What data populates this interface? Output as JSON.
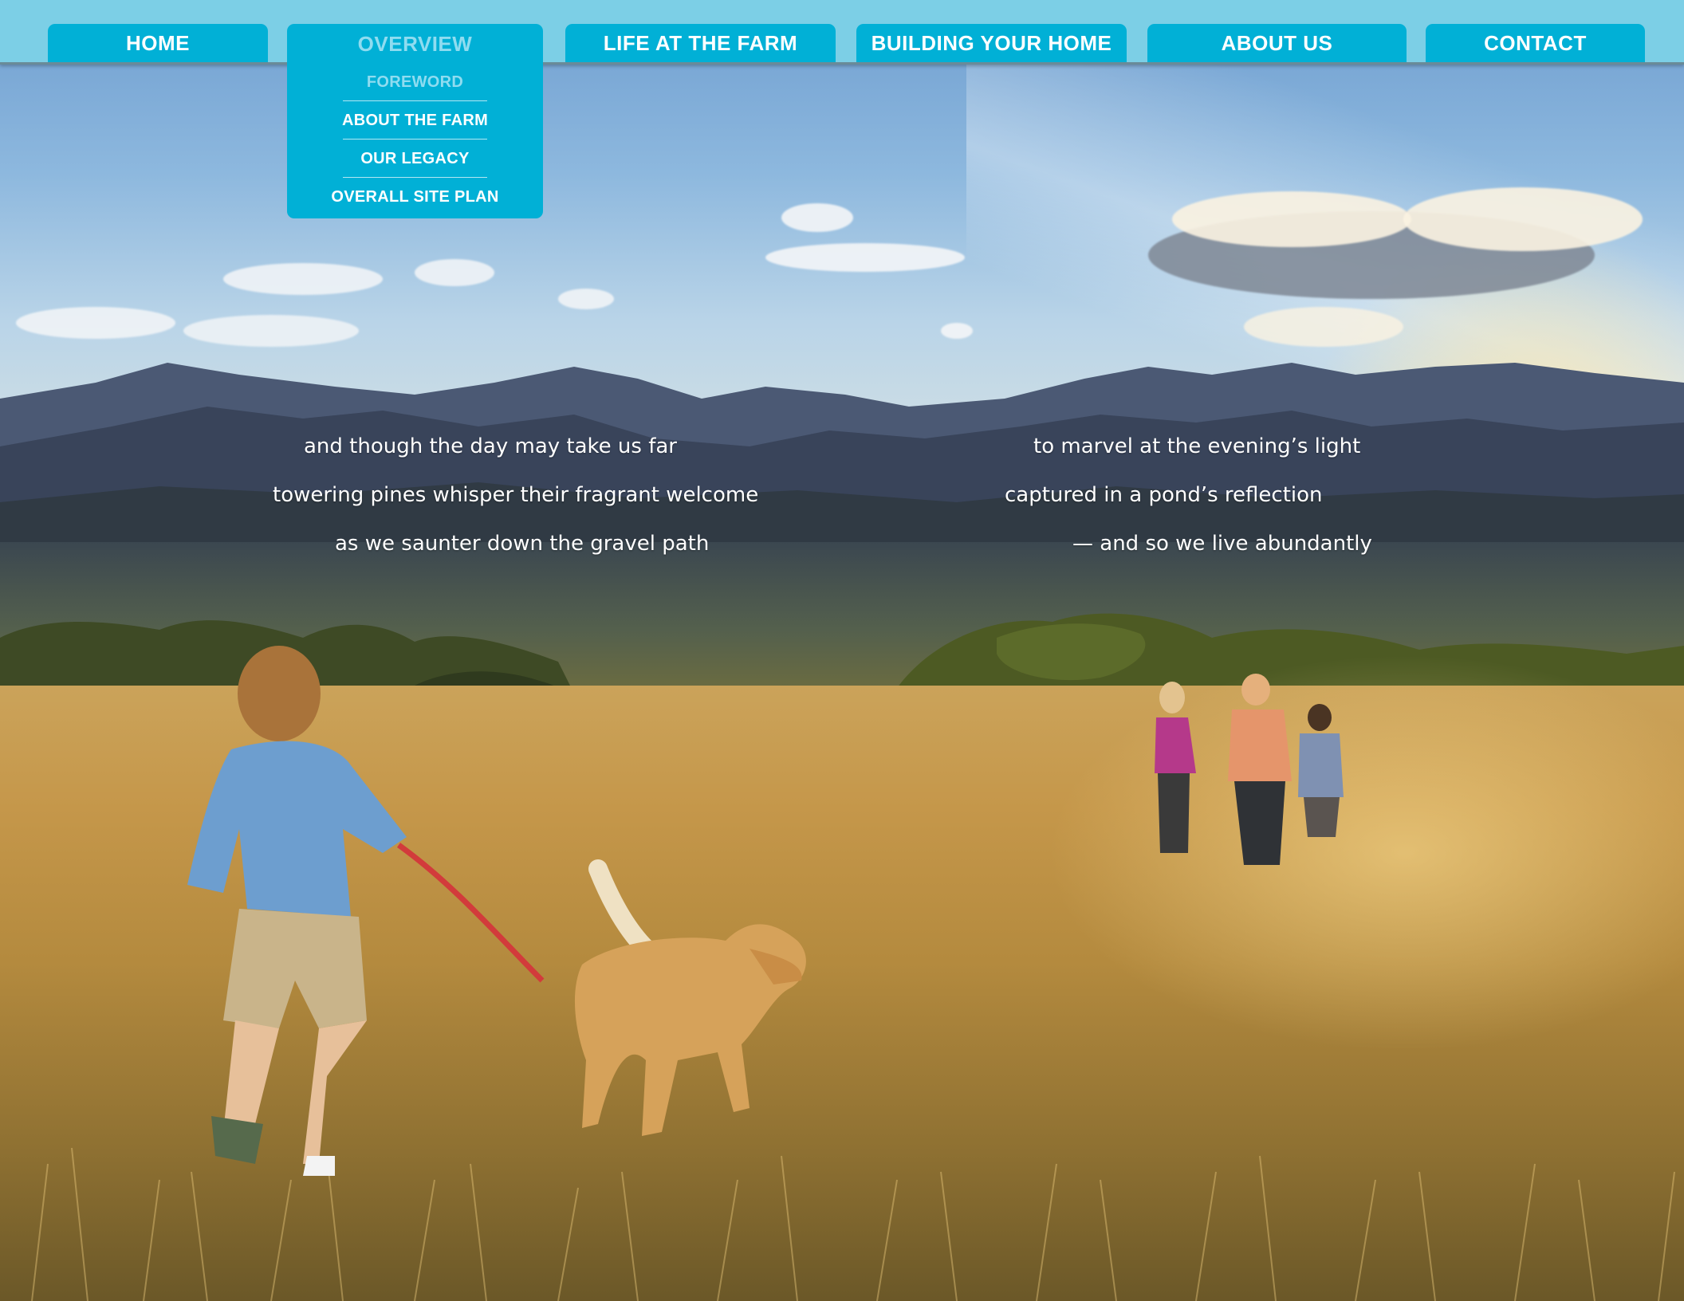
{
  "nav": {
    "tabs": [
      {
        "label": "HOME"
      },
      {
        "label": "OVERVIEW"
      },
      {
        "label": "LIFE AT THE FARM"
      },
      {
        "label": "BUILDING YOUR HOME"
      },
      {
        "label": "ABOUT US"
      },
      {
        "label": "CONTACT"
      }
    ],
    "active_tab": "OVERVIEW",
    "dropdown": {
      "items": [
        {
          "label": "FOREWORD"
        },
        {
          "label": "ABOUT THE FARM"
        },
        {
          "label": "OUR LEGACY"
        },
        {
          "label": "OVERALL SITE PLAN"
        }
      ],
      "current_item": "FOREWORD"
    }
  },
  "poem": {
    "left": [
      "and though the day may take us far",
      "towering pines whisper their fragrant welcome",
      "as we saunter down the gravel path"
    ],
    "right": [
      "to marvel at the evening’s light",
      "captured in a pond’s reflection",
      "— and so we live abundantly"
    ]
  },
  "colors": {
    "nav_tab": "#01b0d6",
    "top_bar": "#7ccfe6",
    "active_text": "#8fdcf0",
    "poem_text": "#ffffff"
  },
  "icons": []
}
